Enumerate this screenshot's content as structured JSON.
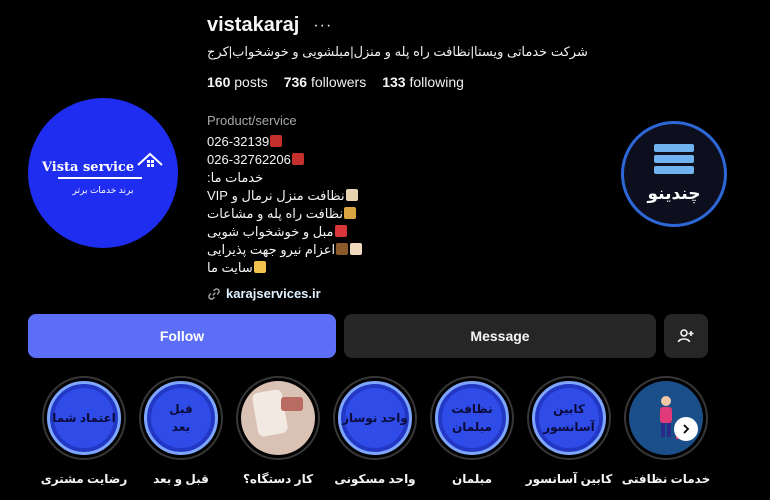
{
  "profile": {
    "username": "vistakaraj",
    "more_icon": "ellipsis-icon",
    "full_name_bio": "شرکت خدماتی ویستا|نظافت راه پله و منزل|مبلشویی و خوشخواب|کرج",
    "stats": {
      "posts_count": "160",
      "posts_label": "posts",
      "followers_count": "736",
      "followers_label": "followers",
      "following_count": "133",
      "following_label": "following"
    },
    "category": "Product/service",
    "bio_lines": [
      "026-32139",
      "026-32762206",
      "خدمات ما:",
      "نظافت منزل نرمال و VIP",
      "نظافت راه پله و مشاعات",
      "مبل و خوشخواب شویی",
      "اعزام نیرو جهت پذیرایی",
      "سایت ما"
    ],
    "link": "karajservices.ir",
    "avatar": {
      "logo_text": "Vista service",
      "tagline": "برند خدمات برتر"
    },
    "badge": {
      "text": "چندینو"
    }
  },
  "actions": {
    "follow": "Follow",
    "message": "Message",
    "add_user_icon": "add-person-icon"
  },
  "highlights": [
    {
      "label": "رضایت مشتری",
      "cover": "اعتماد شما"
    },
    {
      "label": "قبل و بعد",
      "cover_line1": "قبل",
      "cover_line2": "بعد"
    },
    {
      "label": "کار دستگاه؟",
      "cover": ""
    },
    {
      "label": "واحد مسکونی",
      "cover": "واحد نوساز"
    },
    {
      "label": "مبلمان",
      "cover_line1": "نظافت",
      "cover_line2": "مبلمان"
    },
    {
      "label": "کابین آسانسور",
      "cover_line1": "کابین",
      "cover_line2": "آسانسور"
    },
    {
      "label": "خدمات نظافتی",
      "cover": ""
    }
  ],
  "colors": {
    "background": "#000000",
    "follow_button": "#5c6ef8",
    "secondary_button": "#262626",
    "highlight_fill": "#2f4ce8",
    "avatar_fill": "#1f2df0"
  }
}
